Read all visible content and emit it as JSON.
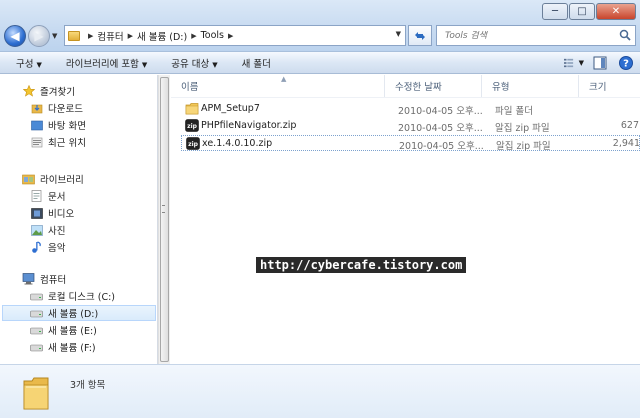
{
  "window": {
    "minimize_glyph": "─",
    "maximize_glyph": "□",
    "close_glyph": "✕"
  },
  "nav": {
    "back_glyph": "◀",
    "forward_glyph": "▶",
    "dropdown_glyph": "▼"
  },
  "address": {
    "crumbs": [
      "컴퓨터",
      "새 볼륨 (D:)",
      "Tools"
    ],
    "separator": "▶"
  },
  "search": {
    "placeholder": "Tools 검색"
  },
  "toolbar": {
    "organize": "구성",
    "include_library": "라이브러리에 포함",
    "share_with": "공유 대상",
    "new_folder": "새 폴더",
    "dropdown_glyph": "▼"
  },
  "sidebar": {
    "favorites": {
      "header": "즐겨찾기",
      "items": [
        "다운로드",
        "바탕 화면",
        "최근 위치"
      ]
    },
    "libraries": {
      "header": "라이브러리",
      "items": [
        "문서",
        "비디오",
        "사진",
        "음악"
      ]
    },
    "computer": {
      "header": "컴퓨터",
      "items": [
        "로컬 디스크 (C:)",
        "새 볼륨 (D:)",
        "새 볼륨 (E:)",
        "새 볼륨 (F:)"
      ],
      "selected_index": 1
    }
  },
  "columns": {
    "name": "이름",
    "date": "수정한 날짜",
    "type": "유형",
    "size": "크기",
    "sort_glyph": "▲"
  },
  "files": [
    {
      "name": "APM_Setup7",
      "date": "2010-04-05 오후...",
      "type": "파일 폴더",
      "size": "",
      "icon": "folder-icon"
    },
    {
      "name": "PHPfileNavigator.zip",
      "date": "2010-04-05 오후...",
      "type": "알집 zip 파일",
      "size": "627",
      "icon": "zip-file-icon"
    },
    {
      "name": "xe.1.4.0.10.zip",
      "date": "2010-04-05 오후...",
      "type": "알집 zip 파일",
      "size": "2,941",
      "icon": "zip-file-icon"
    }
  ],
  "watermark": "http://cybercafe.tistory.com",
  "details": {
    "item_count": "3개 항목"
  },
  "colors": {
    "titlebar": "#c8dbf1",
    "selection": "#d9ebfb",
    "folder": "#e2b03a"
  }
}
